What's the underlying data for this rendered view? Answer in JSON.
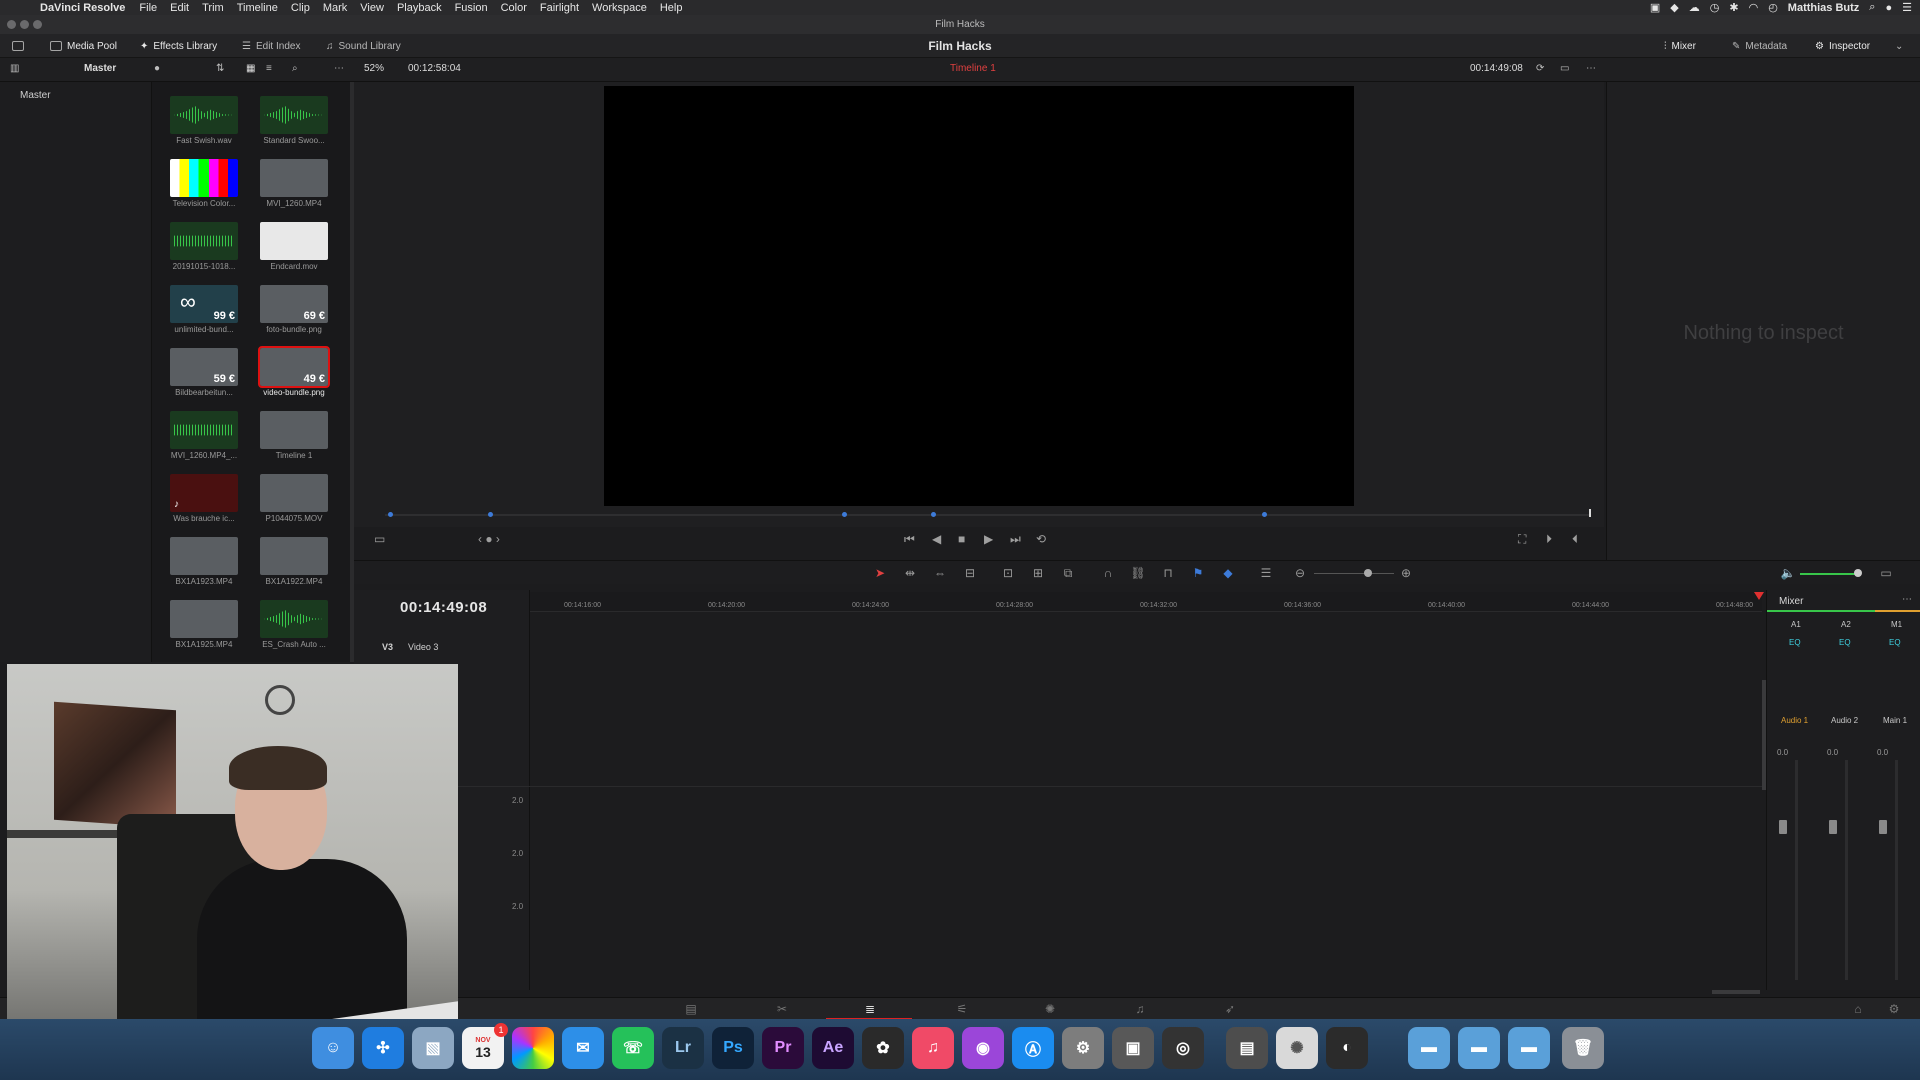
{
  "menubar": {
    "app_name": "DaVinci Resolve",
    "items": [
      "File",
      "Edit",
      "Trim",
      "Timeline",
      "Clip",
      "Mark",
      "View",
      "Playback",
      "Fusion",
      "Color",
      "Fairlight",
      "Workspace",
      "Help"
    ],
    "user": "Matthias Butz"
  },
  "window": {
    "title": "Film Hacks"
  },
  "toolbar": {
    "media_pool": "Media Pool",
    "effects_library": "Effects Library",
    "edit_index": "Edit Index",
    "sound_library": "Sound Library",
    "project_title": "Film Hacks",
    "mixer": "Mixer",
    "metadata": "Metadata",
    "inspector": "Inspector"
  },
  "subbar": {
    "bin_name": "Master",
    "zoom": "52%",
    "source_timecode": "00:12:58:04",
    "timeline_name": "Timeline 1",
    "record_timecode": "00:14:49:08"
  },
  "bins": {
    "master": "Master"
  },
  "media_pool": {
    "clips": [
      {
        "name": "Fast Swish.wav",
        "kind": "audio",
        "selected": false
      },
      {
        "name": "Standard Swoo...",
        "kind": "audio",
        "selected": false
      },
      {
        "name": "Television Color...",
        "kind": "bars",
        "selected": false
      },
      {
        "name": "MVI_1260.MP4",
        "kind": "video",
        "selected": false
      },
      {
        "name": "20191015-1018...",
        "kind": "audio-full",
        "selected": false
      },
      {
        "name": "Endcard.mov",
        "kind": "white",
        "selected": false
      },
      {
        "name": "unlimited-bund...",
        "kind": "infinity",
        "price": "99 €",
        "selected": false
      },
      {
        "name": "foto-bundle.png",
        "kind": "video",
        "price": "69 €",
        "selected": false
      },
      {
        "name": "Bildbearbeitun...",
        "kind": "video",
        "price": "59 €",
        "selected": false
      },
      {
        "name": "video-bundle.png",
        "kind": "video",
        "price": "49 €",
        "selected": true
      },
      {
        "name": "MVI_1260.MP4_...",
        "kind": "audio-full",
        "selected": false
      },
      {
        "name": "Timeline 1",
        "kind": "video",
        "selected": false
      },
      {
        "name": "Was brauche ic...",
        "kind": "redsq",
        "selected": false
      },
      {
        "name": "P1044075.MOV",
        "kind": "video",
        "selected": false
      },
      {
        "name": "BX1A1923.MP4",
        "kind": "video",
        "selected": false
      },
      {
        "name": "BX1A1922.MP4",
        "kind": "video",
        "selected": false
      },
      {
        "name": "BX1A1925.MP4",
        "kind": "video",
        "selected": false
      },
      {
        "name": "ES_Crash Auto ...",
        "kind": "audio",
        "selected": false
      }
    ]
  },
  "inspector": {
    "empty_message": "Nothing to inspect"
  },
  "timeline": {
    "timecode": "00:14:49:08",
    "ruler": [
      "00:14:16:00",
      "00:14:20:00",
      "00:14:24:00",
      "00:14:28:00",
      "00:14:32:00",
      "00:14:36:00",
      "00:14:40:00",
      "00:14:44:00",
      "00:14:48:00"
    ],
    "tracks": [
      {
        "id": "V3",
        "name": "Video 3"
      }
    ],
    "audio_levels": [
      "2.0",
      "2.0",
      "2.0"
    ]
  },
  "mixer": {
    "title": "Mixer",
    "channels": [
      {
        "id": "A1",
        "name": "Audio 1",
        "level": "0.0"
      },
      {
        "id": "A2",
        "name": "Audio 2",
        "level": "0.0"
      },
      {
        "id": "M1",
        "name": "Main 1",
        "level": "0.0"
      }
    ],
    "eq_label": "EQ"
  },
  "dock": {
    "apps": [
      "Finder",
      "Safari",
      "Preview",
      "Calendar",
      "Photos",
      "Messages",
      "WhatsApp",
      "Lr",
      "Ps",
      "Pr",
      "Ae",
      "DaVinci",
      "Music",
      "Podcasts",
      "App Store",
      "System Preferences",
      "Image Capture",
      "Camera",
      "Screenshot",
      "Photo Booth",
      "Motion",
      "Compressor",
      "Folder",
      "Folder",
      "Folder",
      "Trash"
    ],
    "calendar_date": "13",
    "calendar_month": "NOV",
    "calendar_badge": "1",
    "lr": "Lr",
    "ps": "Ps",
    "pr": "Pr",
    "ae": "Ae"
  }
}
